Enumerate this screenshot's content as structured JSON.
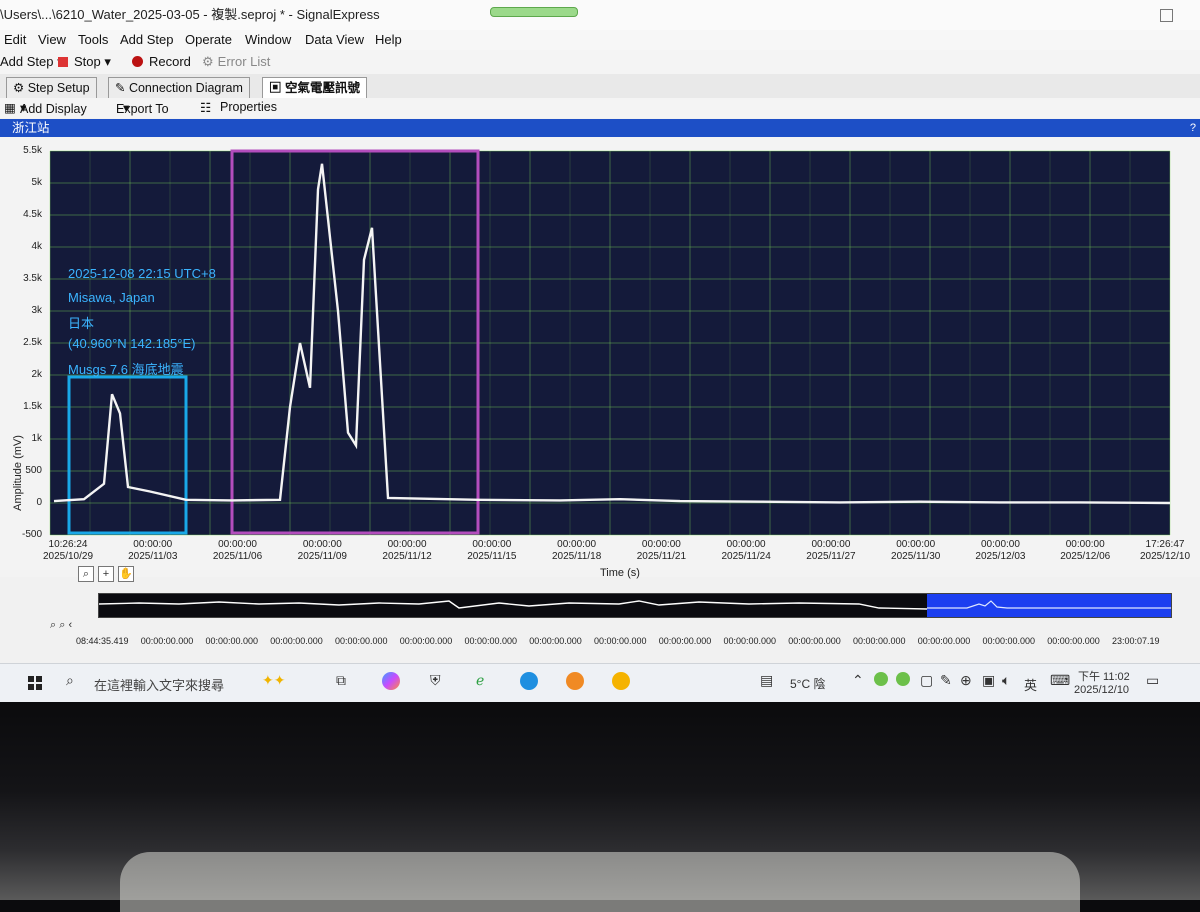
{
  "window": {
    "title": "\\Users\\...\\6210_Water_2025-03-05 - 複製.seproj * - SignalExpress"
  },
  "menu": [
    "Edit",
    "View",
    "Tools",
    "Add Step",
    "Operate",
    "Window",
    "Data View",
    "Help"
  ],
  "toolbar": {
    "add_step": "Add Step",
    "stop": "Stop",
    "record": "Record",
    "error_list": "Error List"
  },
  "tabs": [
    "Step Setup",
    "Connection Diagram",
    "空氣電壓訊號"
  ],
  "display_toolbar": {
    "add_display": "Add Display",
    "export_to": "Export To",
    "properties": "Properties"
  },
  "panel": {
    "title": "浙江站",
    "help": "?"
  },
  "annotation": [
    "2025-12-08 22:15 UTC+8",
    "Misawa, Japan",
    "日本",
    "(40.960°N 142.185°E)",
    "Musgs 7.6 海底地震"
  ],
  "chart_data": {
    "type": "line",
    "ylabel": "Amplitude (mV)",
    "xlabel": "Time (s)",
    "ylim": [
      -500,
      5500
    ],
    "y_ticks": [
      "5.5k",
      "5k",
      "4.5k",
      "4k",
      "3.5k",
      "3k",
      "2.5k",
      "2k",
      "1.5k",
      "1k",
      "500",
      "0",
      "-500"
    ],
    "x_ticks": [
      {
        "time": "10:26:24",
        "date": "2025/10/29"
      },
      {
        "time": "00:00:00",
        "date": "2025/11/03"
      },
      {
        "time": "00:00:00",
        "date": "2025/11/06"
      },
      {
        "time": "00:00:00",
        "date": "2025/11/09"
      },
      {
        "time": "00:00:00",
        "date": "2025/11/12"
      },
      {
        "time": "00:00:00",
        "date": "2025/11/15"
      },
      {
        "time": "00:00:00",
        "date": "2025/11/18"
      },
      {
        "time": "00:00:00",
        "date": "2025/11/21"
      },
      {
        "time": "00:00:00",
        "date": "2025/11/24"
      },
      {
        "time": "00:00:00",
        "date": "2025/11/27"
      },
      {
        "time": "00:00:00",
        "date": "2025/11/30"
      },
      {
        "time": "00:00:00",
        "date": "2025/12/03"
      },
      {
        "time": "00:00:00",
        "date": "2025/12/06"
      },
      {
        "time": "17:26:47",
        "date": "2025/12/10"
      }
    ],
    "series": [
      {
        "x": [
          "2025/10/29",
          "2025/10/30",
          "2025/10/31",
          "2025/10/31",
          "2025/11/01",
          "2025/11/01",
          "2025/11/02",
          "2025/11/03",
          "2025/11/05",
          "2025/11/06",
          "2025/11/06",
          "2025/11/07",
          "2025/11/07",
          "2025/11/08",
          "2025/11/08",
          "2025/11/09",
          "2025/11/09",
          "2025/11/09",
          "2025/11/10",
          "2025/11/10",
          "2025/11/11",
          "2025/11/12",
          "2025/11/15",
          "2025/11/18",
          "2025/11/21",
          "2025/11/24",
          "2025/11/27",
          "2025/11/30",
          "2025/12/03",
          "2025/12/06",
          "2025/12/10"
        ],
        "values": [
          30,
          60,
          300,
          1700,
          1400,
          250,
          180,
          50,
          40,
          50,
          1500,
          2500,
          1800,
          4900,
          5300,
          3000,
          1100,
          900,
          3800,
          4300,
          80,
          50,
          40,
          60,
          30,
          20,
          10,
          20,
          10,
          10,
          0
        ]
      }
    ],
    "highlight_boxes": [
      {
        "color": "#19a8e8",
        "from": "2025/10/29",
        "to": "2025/11/03"
      },
      {
        "color": "#b34dbd",
        "from": "2025/11/05",
        "to": "2025/11/12"
      }
    ],
    "grid": true,
    "plot_background": "#141a3a",
    "grid_color": "#7ed957"
  },
  "overview": {
    "ticks": [
      "08:44:35.419",
      "00:00:00.000",
      "00:00:00.000",
      "00:00:00.000",
      "00:00:00.000",
      "00:00:00.000",
      "00:00:00.000",
      "00:00:00.000",
      "00:00:00.000",
      "00:00:00.000",
      "00:00:00.000",
      "00:00:00.000",
      "00:00:00.000",
      "00:00:00.000",
      "00:00:00.000",
      "00:00:00.000",
      "23:00:07.19"
    ]
  },
  "taskbar": {
    "search_placeholder": "在這裡輸入文字來搜尋",
    "weather": "5°C 陰",
    "lang": "英",
    "time": "下午 11:02",
    "date": "2025/12/10"
  }
}
